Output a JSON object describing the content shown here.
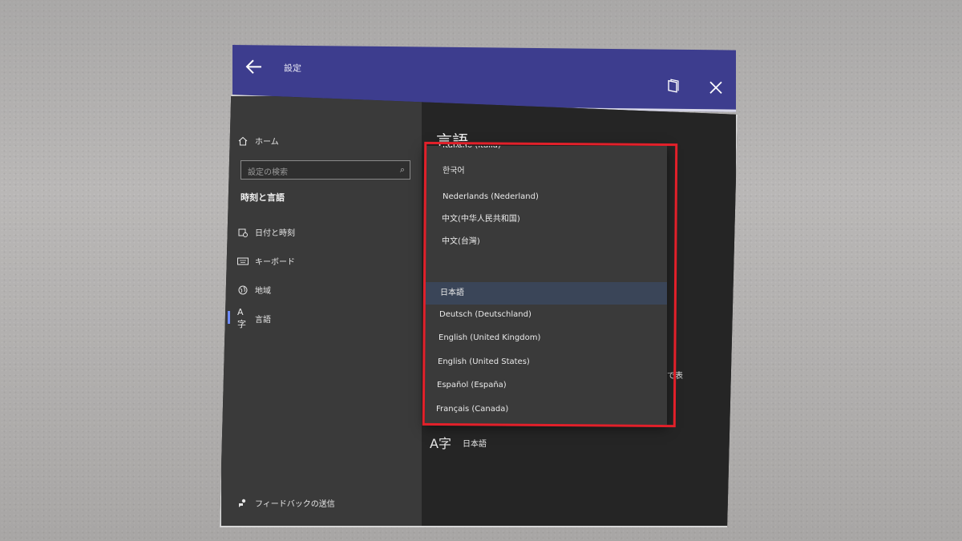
{
  "titlebar": {
    "title": "設定"
  },
  "sidebar": {
    "home_label": "ホーム",
    "search_placeholder": "設定の検索",
    "section_title": "時刻と言語",
    "items": [
      {
        "label": "日付と時刻"
      },
      {
        "label": "キーボード"
      },
      {
        "label": "地域"
      },
      {
        "label": "言語"
      }
    ],
    "feedback_label": "フィードバックの送信"
  },
  "content": {
    "heading": "言語",
    "truncated_text": "で表",
    "display_language": "日本語"
  },
  "dropdown": {
    "selected": "日本語",
    "options": [
      "Italiano (Italia)",
      "한국어",
      "Nederlands (Nederland)",
      "中文(中华人民共和国)",
      "中文(台灣)",
      "日本語",
      "Deutsch (Deutschland)",
      "English (United Kingdom)",
      "English (United States)",
      "Español (España)",
      "Français (Canada)"
    ]
  },
  "colors": {
    "titlebar": "#3d3d8e",
    "sidebar": "#3a3a3a",
    "content": "#252525",
    "highlight_border": "#e2202a",
    "selected_row": "#3a4558"
  }
}
